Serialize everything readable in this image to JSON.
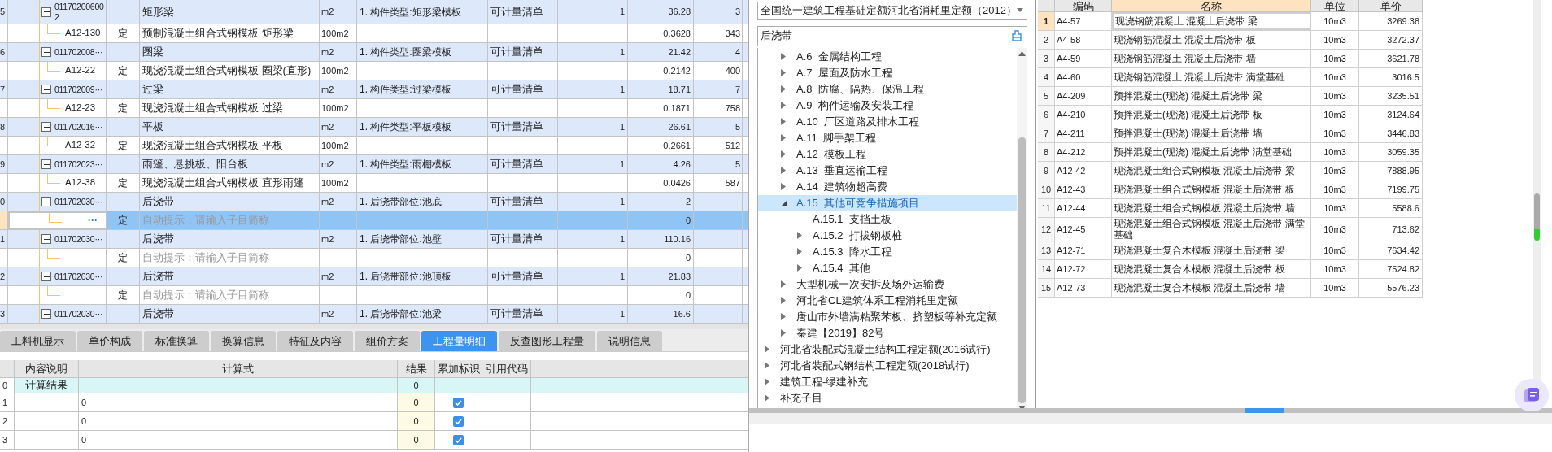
{
  "main_table": {
    "rows": [
      {
        "kind": "list",
        "number": "5",
        "code": "011702006002",
        "name": "矩形梁",
        "unit": "m2",
        "feature": "1. 构件类型:矩形梁模板",
        "category": "可计量清单",
        "qty": "1",
        "amount": "36.28",
        "column_10": "3",
        "expanded": true,
        "selected": false
      },
      {
        "kind": "quota",
        "code": "A12-130",
        "type": "定",
        "name": "预制混凝土组合式钢模板 矩形梁",
        "unit": "100m2",
        "amount": "0.3628",
        "column_10": "343",
        "selected": false
      },
      {
        "kind": "list",
        "number": "6",
        "code": "011702008···",
        "name": "圈梁",
        "unit": "m2",
        "feature": "1. 构件类型:圈梁模板",
        "category": "可计量清单",
        "qty": "1",
        "amount": "21.42",
        "column_10": "4",
        "expanded": true,
        "selected": false
      },
      {
        "kind": "quota",
        "code": "A12-22",
        "type": "定",
        "name": "现浇混凝土组合式钢模板 圈梁(直形)",
        "unit": "100m2",
        "amount": "0.2142",
        "column_10": "400",
        "selected": false
      },
      {
        "kind": "list",
        "number": "7",
        "code": "011702009···",
        "name": "过梁",
        "unit": "m2",
        "feature": "1. 构件类型:过梁模板",
        "category": "可计量清单",
        "qty": "1",
        "amount": "18.71",
        "column_10": "7",
        "expanded": true,
        "selected": false
      },
      {
        "kind": "quota",
        "code": "A12-23",
        "type": "定",
        "name": "现浇混凝土组合式钢模板 过梁",
        "unit": "100m2",
        "amount": "0.1871",
        "column_10": "758",
        "selected": false
      },
      {
        "kind": "list",
        "number": "8",
        "code": "011702016···",
        "name": "平板",
        "unit": "m2",
        "feature": "1. 构件类型:平板模板",
        "category": "可计量清单",
        "qty": "1",
        "amount": "26.61",
        "column_10": "5",
        "expanded": true,
        "selected": false
      },
      {
        "kind": "quota",
        "code": "A12-32",
        "type": "定",
        "name": "现浇混凝土组合式钢模板 平板",
        "unit": "100m2",
        "amount": "0.2661",
        "column_10": "512",
        "selected": false
      },
      {
        "kind": "list",
        "number": "9",
        "code": "011702023···",
        "name": "雨篷、悬挑板、阳台板",
        "unit": "m2",
        "feature": "1. 构件类型:雨棚模板",
        "category": "可计量清单",
        "qty": "1",
        "amount": "4.26",
        "column_10": "5",
        "expanded": true,
        "selected": false
      },
      {
        "kind": "quota",
        "code": "A12-38",
        "type": "定",
        "name": "现浇混凝土组合式钢模板 直形雨篷",
        "unit": "100m2",
        "amount": "0.0426",
        "column_10": "587",
        "selected": false
      },
      {
        "kind": "list",
        "number": "0",
        "code": "011702030···",
        "name": "后浇带",
        "unit": "m2",
        "feature": "1. 后浇带部位:池底",
        "category": "可计量清单",
        "qty": "1",
        "amount": "2",
        "expanded": true,
        "selected": false
      },
      {
        "kind": "quota",
        "button": "···",
        "type": "定",
        "placeholder": "自动提示：请输入子目简称",
        "amount": "0",
        "selected": true
      },
      {
        "kind": "list",
        "number": "1",
        "code": "011702030···",
        "name": "后浇带",
        "unit": "m2",
        "feature": "1. 后浇带部位:池壁",
        "category": "可计量清单",
        "qty": "1",
        "amount": "110.16",
        "expanded": true,
        "selected": false
      },
      {
        "kind": "quota",
        "type": "定",
        "placeholder": "自动提示：请输入子目简称",
        "amount": "0",
        "selected": false
      },
      {
        "kind": "list",
        "number": "2",
        "code": "011702030···",
        "name": "后浇带",
        "unit": "m2",
        "feature": "1. 后浇带部位:池顶板",
        "category": "可计量清单",
        "qty": "1",
        "amount": "21.83",
        "expanded": true,
        "selected": false
      },
      {
        "kind": "quota",
        "type": "定",
        "placeholder": "自动提示：请输入子目简称",
        "amount": "0",
        "selected": false
      },
      {
        "kind": "list",
        "number": "3",
        "code": "011702030···",
        "name": "后浇带",
        "unit": "m2",
        "feature": "1. 后浇带部位:池梁",
        "category": "可计量清单",
        "qty": "1",
        "amount": "16.6",
        "expanded": true,
        "selected": false
      }
    ]
  },
  "detail_tabs": [
    {
      "label": "工料机显示",
      "selected": false
    },
    {
      "label": "单价构成",
      "selected": false
    },
    {
      "label": "标准换算",
      "selected": false
    },
    {
      "label": "换算信息",
      "selected": false
    },
    {
      "label": "特征及内容",
      "selected": false
    },
    {
      "label": "组价方案",
      "selected": false
    },
    {
      "label": "工程量明细",
      "selected": true
    },
    {
      "label": "反查图形工程量",
      "selected": false
    },
    {
      "label": "说明信息",
      "selected": false
    }
  ],
  "quantity_table": {
    "columns": [
      "内容说明",
      "计算式",
      "结果",
      "累加标识",
      "引用代码"
    ],
    "rows": [
      {
        "kind": "total",
        "number": "0",
        "description": "计算结果",
        "result": "0"
      },
      {
        "kind": "line",
        "number": "1",
        "formula": "0",
        "result": "0",
        "accumulate": true
      },
      {
        "kind": "line",
        "number": "2",
        "formula": "0",
        "result": "0",
        "accumulate": true
      },
      {
        "kind": "line",
        "number": "3",
        "formula": "0",
        "result": "0",
        "accumulate": true
      }
    ]
  },
  "quota_library": {
    "value": "全国统一建筑工程基础定额河北省消耗里定额（2012）"
  },
  "search": {
    "value": "后浇带"
  },
  "tree": {
    "continued_items": [
      {
        "label": "A.6  金属结构工程",
        "expandable": true,
        "expanded": false,
        "selected": false
      },
      {
        "label": "A.7  屋面及防水工程",
        "expandable": true,
        "expanded": false,
        "selected": false
      },
      {
        "label": "A.8  防腐、隔热、保温工程",
        "expandable": true,
        "expanded": false,
        "selected": false
      },
      {
        "label": "A.9  构件运输及安装工程",
        "expandable": true,
        "expanded": false,
        "selected": false
      },
      {
        "label": "A.10  厂区道路及排水工程",
        "expandable": true,
        "expanded": false,
        "selected": false
      },
      {
        "label": "A.11  脚手架工程",
        "expandable": true,
        "expanded": false,
        "selected": false
      },
      {
        "label": "A.12  模板工程",
        "expandable": true,
        "expanded": false,
        "selected": false
      },
      {
        "label": "A.13  垂直运输工程",
        "expandable": true,
        "expanded": false,
        "selected": false
      },
      {
        "label": "A.14  建筑物超高费",
        "expandable": true,
        "expanded": false,
        "selected": false
      },
      {
        "label": "A.15  其他可竞争措施项目",
        "expandable": true,
        "expanded": true,
        "selected": true,
        "children": [
          {
            "label": "A.15.1  支挡土板",
            "expandable": false,
            "selected": false
          },
          {
            "label": "A.15.2  打拔钢板桩",
            "expandable": true,
            "expanded": false,
            "selected": false
          },
          {
            "label": "A.15.3  降水工程",
            "expandable": true,
            "expanded": false,
            "selected": false
          },
          {
            "label": "A.15.4  其他",
            "expandable": true,
            "expanded": false,
            "selected": false
          }
        ]
      },
      {
        "label": "大型机械一次安拆及场外运输费",
        "expandable": true,
        "expanded": false,
        "selected": false
      },
      {
        "label": "河北省CL建筑体系工程消耗里定额",
        "expandable": true,
        "expanded": false,
        "selected": false
      },
      {
        "label": "唐山市外墙满粘聚苯板、挤塑板等补充定额",
        "expandable": true,
        "expanded": false,
        "selected": false
      },
      {
        "label": "秦建【2019】82号",
        "expandable": true,
        "expanded": false,
        "selected": false
      }
    ],
    "items": [
      {
        "label": "河北省装配式混凝土结构工程定额(2016试行)",
        "expandable": true,
        "expanded": false,
        "selected": false
      },
      {
        "label": "河北省装配式钢结构工程定额(2018试行)",
        "expandable": true,
        "expanded": false,
        "selected": false
      },
      {
        "label": "建筑工程-绿建补充",
        "expandable": true,
        "expanded": false,
        "selected": false
      },
      {
        "label": "补充子目",
        "expandable": true,
        "expanded": false,
        "selected": false
      }
    ]
  },
  "result_table": {
    "columns": [
      "编码",
      "名称",
      "单位",
      "单价"
    ],
    "rows": [
      {
        "number": "1",
        "code": "A4-57",
        "name": "现浇钢筋混凝土 混凝土后浇带 梁",
        "unit": "10m3",
        "price": "3269.38",
        "selected": true
      },
      {
        "number": "2",
        "code": "A4-58",
        "name": "现浇钢筋混凝土 混凝土后浇带 板",
        "unit": "10m3",
        "price": "3272.37",
        "selected": false
      },
      {
        "number": "3",
        "code": "A4-59",
        "name": "现浇钢筋混凝土 混凝土后浇带 墙",
        "unit": "10m3",
        "price": "3621.78",
        "selected": false
      },
      {
        "number": "4",
        "code": "A4-60",
        "name": "现浇钢筋混凝土 混凝土后浇带 满堂基础",
        "unit": "10m3",
        "price": "3016.5",
        "selected": false
      },
      {
        "number": "5",
        "code": "A4-209",
        "name": "预拌混凝土(现浇) 混凝土后浇带 梁",
        "unit": "10m3",
        "price": "3235.51",
        "selected": false
      },
      {
        "number": "6",
        "code": "A4-210",
        "name": "预拌混凝土(现浇) 混凝土后浇带 板",
        "unit": "10m3",
        "price": "3124.64",
        "selected": false
      },
      {
        "number": "7",
        "code": "A4-211",
        "name": "预拌混凝土(现浇) 混凝土后浇带 墙",
        "unit": "10m3",
        "price": "3446.83",
        "selected": false
      },
      {
        "number": "8",
        "code": "A4-212",
        "name": "预拌混凝土(现浇) 混凝土后浇带 满堂基础",
        "unit": "10m3",
        "price": "3059.35",
        "selected": false
      },
      {
        "number": "9",
        "code": "A12-42",
        "name": "现浇混凝土组合式钢模板 混凝土后浇带 梁",
        "unit": "10m3",
        "price": "7888.95",
        "selected": false
      },
      {
        "number": "10",
        "code": "A12-43",
        "name": "现浇混凝土组合式钢模板 混凝土后浇带 板",
        "unit": "10m3",
        "price": "7199.75",
        "selected": false
      },
      {
        "number": "11",
        "code": "A12-44",
        "name": "现浇混凝土组合式钢模板 混凝土后浇带 墙",
        "unit": "10m3",
        "price": "5588.6",
        "selected": false
      },
      {
        "number": "12",
        "code": "A12-45",
        "name": "现浇混凝土组合式钢模板 混凝土后浇带 满堂基础",
        "unit": "10m3",
        "price": "713.62",
        "selected": false
      },
      {
        "number": "13",
        "code": "A12-71",
        "name": "现浇混凝土复合木模板 混凝土后浇带 梁",
        "unit": "10m3",
        "price": "7634.42",
        "selected": false
      },
      {
        "number": "14",
        "code": "A12-72",
        "name": "现浇混凝土复合木模板 混凝土后浇带 板",
        "unit": "10m3",
        "price": "7524.82",
        "selected": false
      },
      {
        "number": "15",
        "code": "A12-73",
        "name": "现浇混凝土复合木模板 混凝土后浇带 墙",
        "unit": "10m3",
        "price": "5576.23",
        "selected": false
      }
    ]
  }
}
